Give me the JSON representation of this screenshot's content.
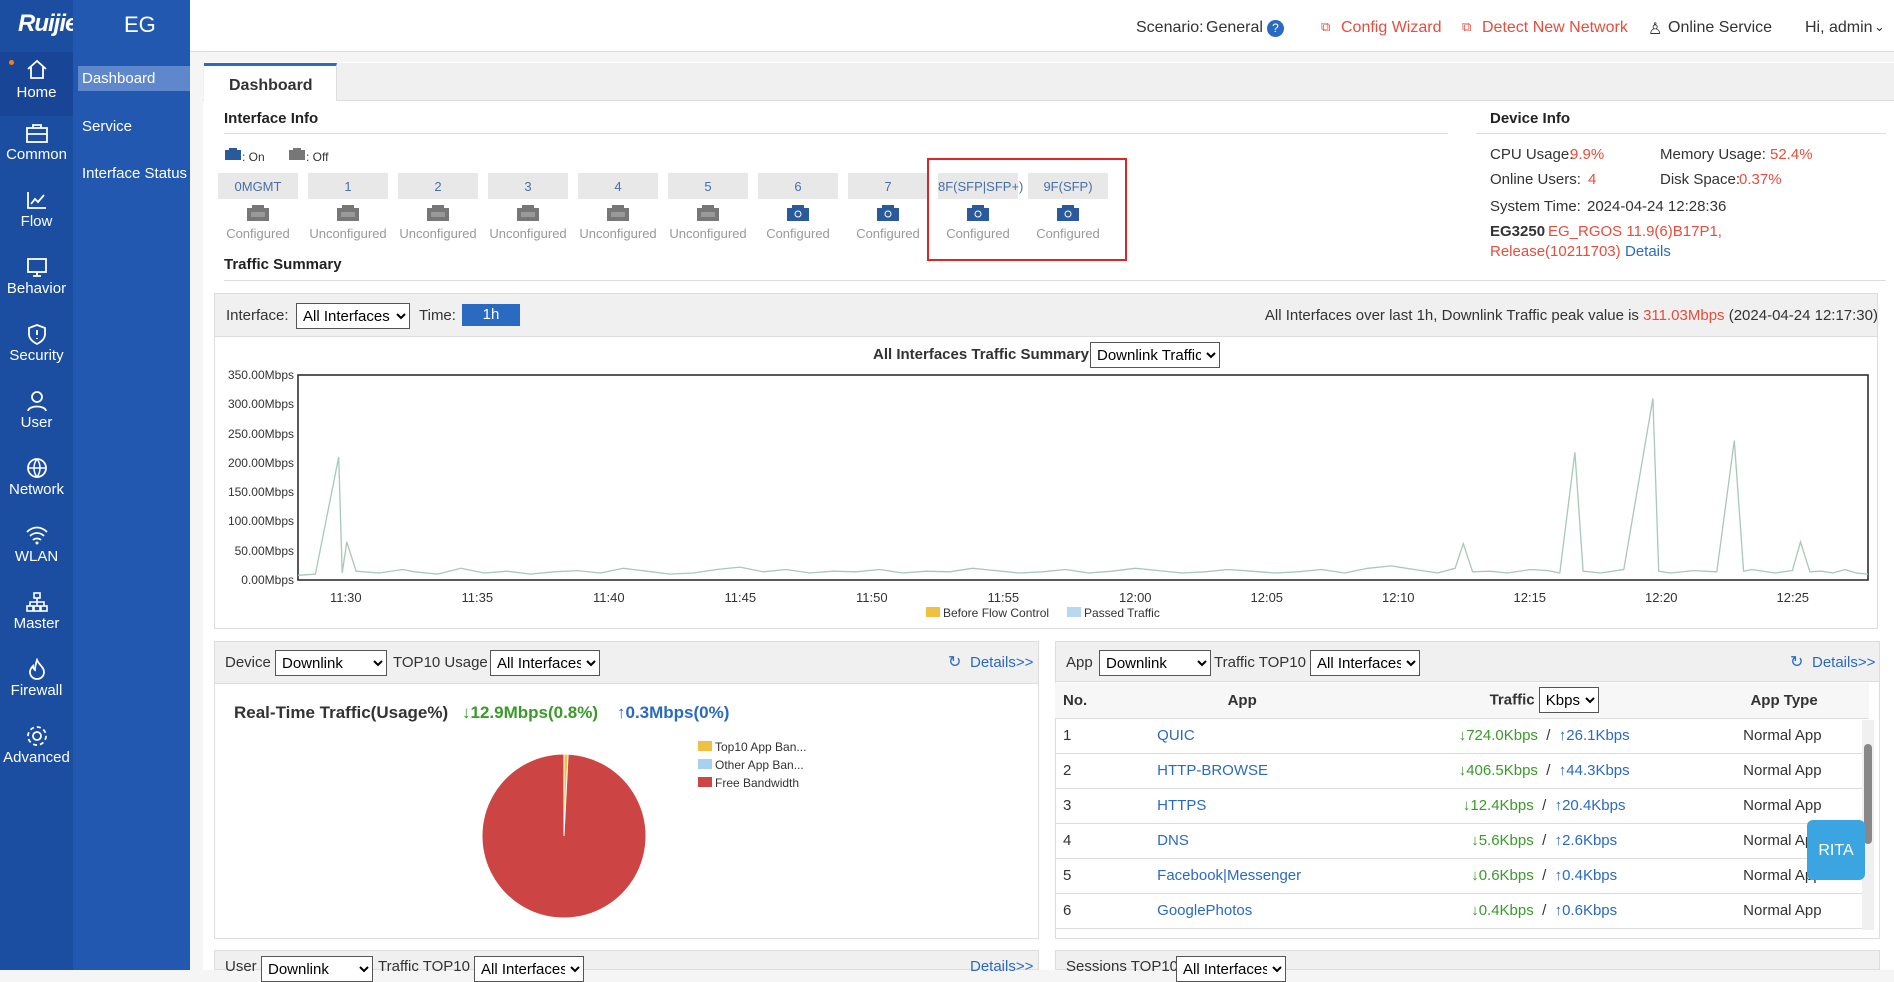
{
  "brand": {
    "logo": "Ruijie",
    "product": "EG"
  },
  "nav": [
    {
      "label": "Home"
    },
    {
      "label": "Common"
    },
    {
      "label": "Flow"
    },
    {
      "label": "Behavior"
    },
    {
      "label": "Security"
    },
    {
      "label": "User"
    },
    {
      "label": "Network"
    },
    {
      "label": "WLAN"
    },
    {
      "label": "Master"
    },
    {
      "label": "Firewall"
    },
    {
      "label": "Advanced"
    }
  ],
  "subnav": [
    {
      "label": "Dashboard"
    },
    {
      "label": "Service"
    },
    {
      "label": "Interface Status"
    }
  ],
  "topbar": {
    "scenario_label": "Scenario:",
    "scenario_value": "General",
    "config_wizard": "Config Wizard",
    "detect": "Detect New Network",
    "online_service": "Online Service",
    "user": "Hi, admin"
  },
  "tab": "Dashboard",
  "interface_info": {
    "title": "Interface Info",
    "legend_on": ": On",
    "legend_off": ": Off",
    "ports": [
      {
        "name": "0MGMT",
        "status": "Configured",
        "on": false
      },
      {
        "name": "1",
        "status": "Unconfigured",
        "on": false
      },
      {
        "name": "2",
        "status": "Unconfigured",
        "on": false
      },
      {
        "name": "3",
        "status": "Unconfigured",
        "on": false
      },
      {
        "name": "4",
        "status": "Unconfigured",
        "on": false
      },
      {
        "name": "5",
        "status": "Unconfigured",
        "on": false
      },
      {
        "name": "6",
        "status": "Configured",
        "on": true
      },
      {
        "name": "7",
        "status": "Configured",
        "on": true
      },
      {
        "name": "8F(SFP|SFP+)",
        "status": "Configured",
        "on": true
      },
      {
        "name": "9F(SFP)",
        "status": "Configured",
        "on": true
      }
    ]
  },
  "device_info": {
    "title": "Device Info",
    "cpu_label": "CPU Usage:",
    "cpu": "9.9%",
    "mem_label": "Memory Usage:",
    "mem": "52.4%",
    "users_label": "Online Users:",
    "users": "4",
    "disk_label": "Disk Space:",
    "disk": "0.37%",
    "time_label": "System Time:",
    "time": "2024-04-24 12:28:36",
    "model": "EG3250",
    "version": "EG_RGOS 11.9(6)B17P1,",
    "release": "Release(10211703)",
    "details": "Details"
  },
  "traffic": {
    "title": "Traffic Summary",
    "interface_label": "Interface:",
    "interface_value": "All Interfaces",
    "time_label": "Time:",
    "time_value": "1h",
    "peak_prefix": "All Interfaces over last 1h, Downlink Traffic peak value is ",
    "peak_value": "311.03Mbps",
    "peak_suffix": " (2024-04-24 12:17:30)",
    "chart_title": "All Interfaces Traffic Summary",
    "mode": "Downlink Traffic",
    "legend_before": "Before Flow Control",
    "legend_passed": "Passed Traffic"
  },
  "chart_data": {
    "type": "line",
    "title": "All Interfaces Traffic Summary",
    "ylim": [
      0,
      350
    ],
    "yticks": [
      "350.00Mbps",
      "300.00Mbps",
      "250.00Mbps",
      "200.00Mbps",
      "150.00Mbps",
      "100.00Mbps",
      "50.00Mbps",
      "0.00Mbps"
    ],
    "xticks": [
      "11:30",
      "11:35",
      "11:40",
      "11:45",
      "11:50",
      "11:55",
      "12:00",
      "12:05",
      "12:10",
      "12:15",
      "12:20",
      "12:25"
    ],
    "series": [
      {
        "name": "Passed Traffic",
        "points": [
          [
            0,
            8
          ],
          [
            1.5,
            10
          ],
          [
            3.5,
            210
          ],
          [
            3.8,
            12
          ],
          [
            4.2,
            65
          ],
          [
            5,
            15
          ],
          [
            7,
            12
          ],
          [
            9,
            18
          ],
          [
            10,
            14
          ],
          [
            12,
            10
          ],
          [
            14,
            20
          ],
          [
            16,
            12
          ],
          [
            18,
            15
          ],
          [
            20,
            10
          ],
          [
            22,
            14
          ],
          [
            24,
            16
          ],
          [
            26,
            12
          ],
          [
            28,
            20
          ],
          [
            30,
            15
          ],
          [
            32,
            10
          ],
          [
            34,
            12
          ],
          [
            36,
            18
          ],
          [
            38,
            22
          ],
          [
            40,
            14
          ],
          [
            42,
            18
          ],
          [
            44,
            12
          ],
          [
            46,
            15
          ],
          [
            48,
            14
          ],
          [
            50,
            18
          ],
          [
            52,
            12
          ],
          [
            54,
            15
          ],
          [
            56,
            14
          ],
          [
            58,
            20
          ],
          [
            60,
            16
          ],
          [
            62,
            12
          ],
          [
            64,
            14
          ],
          [
            66,
            18
          ],
          [
            68,
            12
          ],
          [
            70,
            15
          ],
          [
            72,
            20
          ],
          [
            74,
            16
          ],
          [
            76,
            12
          ],
          [
            78,
            14
          ],
          [
            80,
            18
          ],
          [
            82,
            15
          ],
          [
            84,
            12
          ],
          [
            86,
            14
          ],
          [
            88,
            18
          ],
          [
            90,
            12
          ],
          [
            92,
            20
          ],
          [
            94,
            24
          ],
          [
            96,
            18
          ],
          [
            98,
            12
          ],
          [
            99.5,
            20
          ],
          [
            100.2,
            62
          ],
          [
            101,
            14
          ],
          [
            102.5,
            15
          ],
          [
            104,
            12
          ],
          [
            106,
            18
          ],
          [
            107.5,
            16
          ],
          [
            108.5,
            12
          ],
          [
            109.8,
            218
          ],
          [
            110.5,
            15
          ],
          [
            112,
            12
          ],
          [
            114,
            18
          ],
          [
            116.5,
            310
          ],
          [
            117,
            15
          ],
          [
            118,
            12
          ],
          [
            120,
            16
          ],
          [
            122,
            14
          ],
          [
            123.5,
            238
          ],
          [
            124.3,
            15
          ],
          [
            125,
            18
          ],
          [
            127,
            12
          ],
          [
            128.5,
            16
          ],
          [
            129.2,
            65
          ],
          [
            130,
            14
          ],
          [
            131,
            15
          ],
          [
            132,
            12
          ],
          [
            133,
            18
          ],
          [
            134,
            12
          ],
          [
            135,
            10
          ]
        ]
      }
    ]
  },
  "device_top": {
    "device_label": "Device",
    "device_mode": "Downlink",
    "usage_label": "TOP10 Usage",
    "iface": "All Interfaces",
    "details": "Details>>",
    "rt_label": "Real-Time Traffic(Usage%)",
    "down": "↓12.9Mbps(0.8%)",
    "up": "↑0.3Mbps(0%)",
    "legend": [
      "Top10 App Ban...",
      "Other App Ban...",
      "Free Bandwidth"
    ]
  },
  "pie_data": {
    "type": "pie",
    "values": [
      0.8,
      0,
      99.2
    ],
    "colors": [
      "#f0c040",
      "#a8d0f0",
      "#cc4444"
    ]
  },
  "app_top": {
    "app_label": "App",
    "app_mode": "Downlink",
    "traffic_label": "Traffic TOP10",
    "iface": "All Interfaces",
    "details": "Details>>",
    "col_no": "No.",
    "col_app": "App",
    "col_traffic": "Traffic",
    "unit": "Kbps",
    "col_type": "App Type",
    "rows": [
      {
        "no": "1",
        "app": "QUIC",
        "down": "↓724.0Kbps",
        "up": "↑26.1Kbps",
        "type": "Normal App"
      },
      {
        "no": "2",
        "app": "HTTP-BROWSE",
        "down": "↓406.5Kbps",
        "up": "↑44.3Kbps",
        "type": "Normal App"
      },
      {
        "no": "3",
        "app": "HTTPS",
        "down": "↓12.4Kbps",
        "up": "↑20.4Kbps",
        "type": "Normal App"
      },
      {
        "no": "4",
        "app": "DNS",
        "down": "↓5.6Kbps",
        "up": "↑2.6Kbps",
        "type": "Normal App"
      },
      {
        "no": "5",
        "app": "Facebook|Messenger",
        "down": "↓0.6Kbps",
        "up": "↑0.4Kbps",
        "type": "Normal App"
      },
      {
        "no": "6",
        "app": "GooglePhotos",
        "down": "↓0.4Kbps",
        "up": "↑0.6Kbps",
        "type": "Normal App"
      }
    ]
  },
  "bottom": {
    "user_label": "User",
    "user_mode": "Downlink",
    "traffic_label": "Traffic TOP10",
    "iface": "All Interfaces",
    "details": "Details>>",
    "sessions_label": "Sessions TOP10",
    "sessions_iface": "All Interfaces"
  },
  "rita": "RITA"
}
